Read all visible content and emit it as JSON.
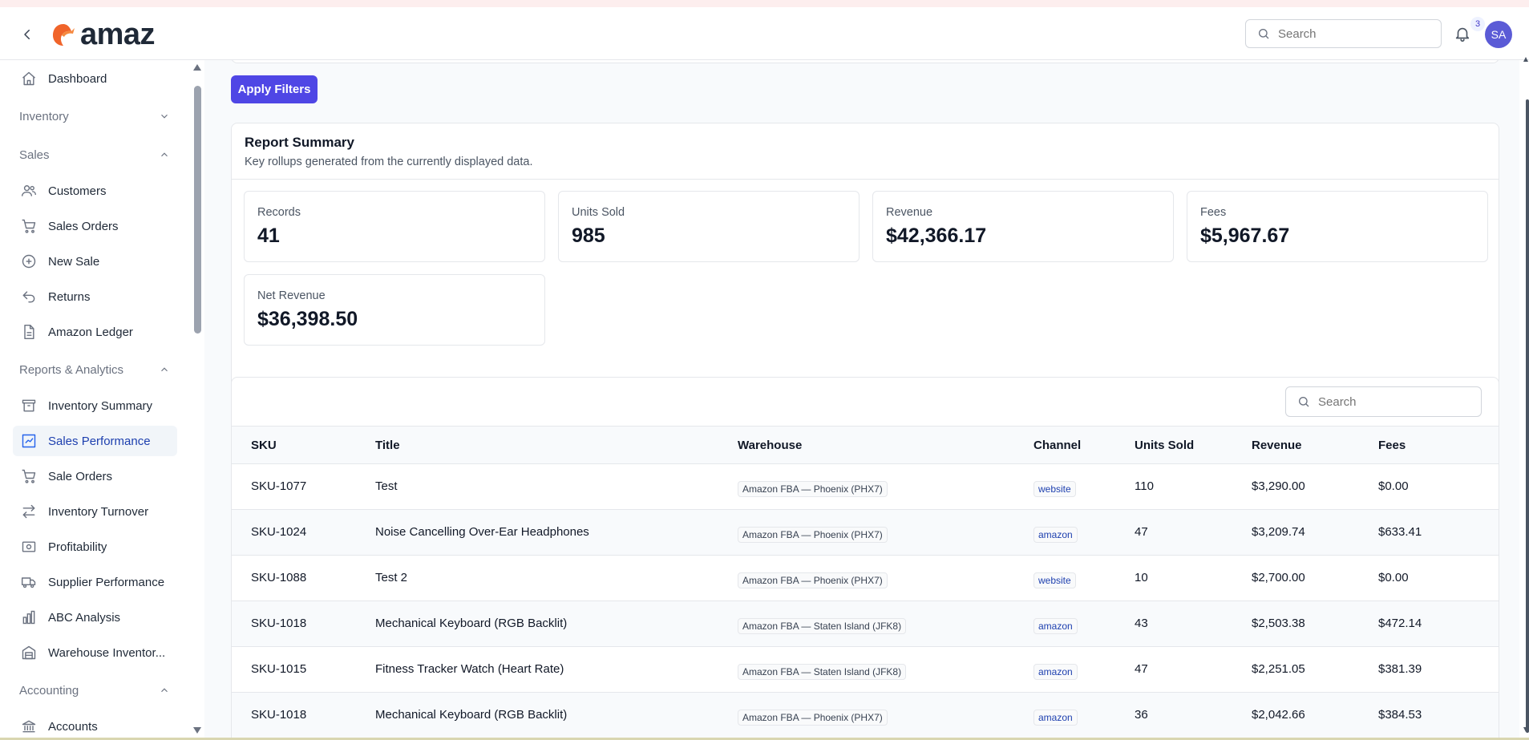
{
  "header": {
    "logo_text": "amaz",
    "search_placeholder": "Search",
    "notification_count": "3",
    "avatar_initials": "SA",
    "brand_color": "#4f46e5"
  },
  "sidebar": {
    "dashboard": "Dashboard",
    "inventory_section": "Inventory",
    "sales_section": "Sales",
    "sales_items": [
      "Customers",
      "Sales Orders",
      "New Sale",
      "Returns",
      "Amazon Ledger"
    ],
    "reports_section": "Reports & Analytics",
    "reports_items": [
      "Inventory Summary",
      "Sales Performance",
      "Sale Orders",
      "Inventory Turnover",
      "Profitability",
      "Supplier Performance",
      "ABC Analysis",
      "Warehouse Inventor..."
    ],
    "active_item": "Sales Performance",
    "accounting_section": "Accounting",
    "accounting_items": [
      "Accounts"
    ]
  },
  "filters": {
    "apply_label": "Apply Filters"
  },
  "summary": {
    "title": "Report Summary",
    "subtitle": "Key rollups generated from the currently displayed data.",
    "metrics": [
      {
        "label": "Records",
        "value": "41"
      },
      {
        "label": "Units Sold",
        "value": "985"
      },
      {
        "label": "Revenue",
        "value": "$42,366.17"
      },
      {
        "label": "Fees",
        "value": "$5,967.67"
      },
      {
        "label": "Net Revenue",
        "value": "$36,398.50"
      }
    ]
  },
  "table": {
    "search_placeholder": "Search",
    "columns": [
      "SKU",
      "Title",
      "Warehouse",
      "Channel",
      "Units Sold",
      "Revenue",
      "Fees"
    ],
    "rows": [
      {
        "sku": "SKU-1077",
        "title": "Test",
        "warehouse": "Amazon FBA — Phoenix (PHX7)",
        "channel": "website",
        "units": "110",
        "revenue": "$3,290.00",
        "fees": "$0.00"
      },
      {
        "sku": "SKU-1024",
        "title": "Noise Cancelling Over-Ear Headphones",
        "warehouse": "Amazon FBA — Phoenix (PHX7)",
        "channel": "amazon",
        "units": "47",
        "revenue": "$3,209.74",
        "fees": "$633.41"
      },
      {
        "sku": "SKU-1088",
        "title": "Test 2",
        "warehouse": "Amazon FBA — Phoenix (PHX7)",
        "channel": "website",
        "units": "10",
        "revenue": "$2,700.00",
        "fees": "$0.00"
      },
      {
        "sku": "SKU-1018",
        "title": "Mechanical Keyboard (RGB Backlit)",
        "warehouse": "Amazon FBA — Staten Island (JFK8)",
        "channel": "amazon",
        "units": "43",
        "revenue": "$2,503.38",
        "fees": "$472.14"
      },
      {
        "sku": "SKU-1015",
        "title": "Fitness Tracker Watch (Heart Rate)",
        "warehouse": "Amazon FBA — Staten Island (JFK8)",
        "channel": "amazon",
        "units": "47",
        "revenue": "$2,251.05",
        "fees": "$381.39"
      },
      {
        "sku": "SKU-1018",
        "title": "Mechanical Keyboard (RGB Backlit)",
        "warehouse": "Amazon FBA — Phoenix (PHX7)",
        "channel": "amazon",
        "units": "36",
        "revenue": "$2,042.66",
        "fees": "$384.53"
      }
    ]
  }
}
